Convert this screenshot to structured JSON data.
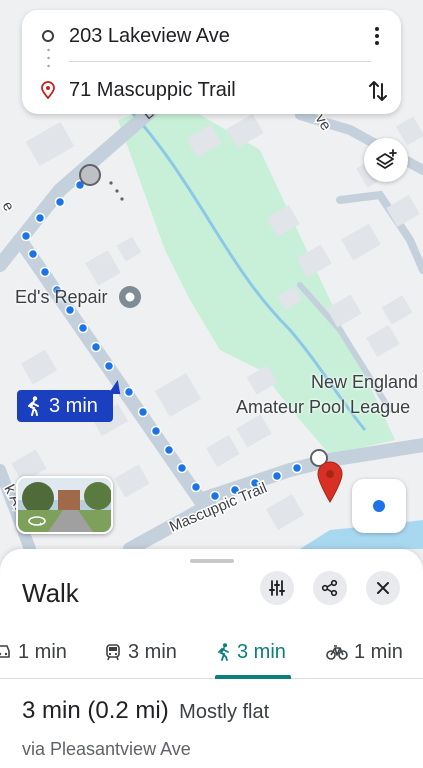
{
  "route": {
    "origin": "203 Lakeview Ave",
    "destination": "71 Mascuppic Trail"
  },
  "map": {
    "poi_eds_repair": "Ed's Repair",
    "poi_pool_league_line1": "New England",
    "poi_pool_league_line2": "Amateur Pool League",
    "street_mascuppic": "Mascuppic Trail",
    "street_ave_fragment": "ve",
    "street_left_fragment": "e",
    "street_bottom_left_fragment": "k Av",
    "walk_badge": "3 min"
  },
  "sheet": {
    "title": "Walk",
    "modes": [
      {
        "name": "drive",
        "label": "1 min",
        "icon": "car-icon"
      },
      {
        "name": "transit",
        "label": "3 min",
        "icon": "train-icon"
      },
      {
        "name": "walk",
        "label": "3 min",
        "icon": "walk-icon",
        "active": true
      },
      {
        "name": "bike",
        "label": "1 min",
        "icon": "bike-icon"
      }
    ],
    "summary_time": "3 min (0.2 mi)",
    "summary_terrain": "Mostly flat",
    "via": "via Pleasantview Ave"
  },
  "colors": {
    "accent_teal": "#0b7f79",
    "walk_badge_blue": "#1a3fbf",
    "route_dot_blue": "#1a73e8",
    "park_green": "#c8f0d8",
    "water_blue": "#a8d8f0",
    "dest_pin_red": "#d93025"
  }
}
